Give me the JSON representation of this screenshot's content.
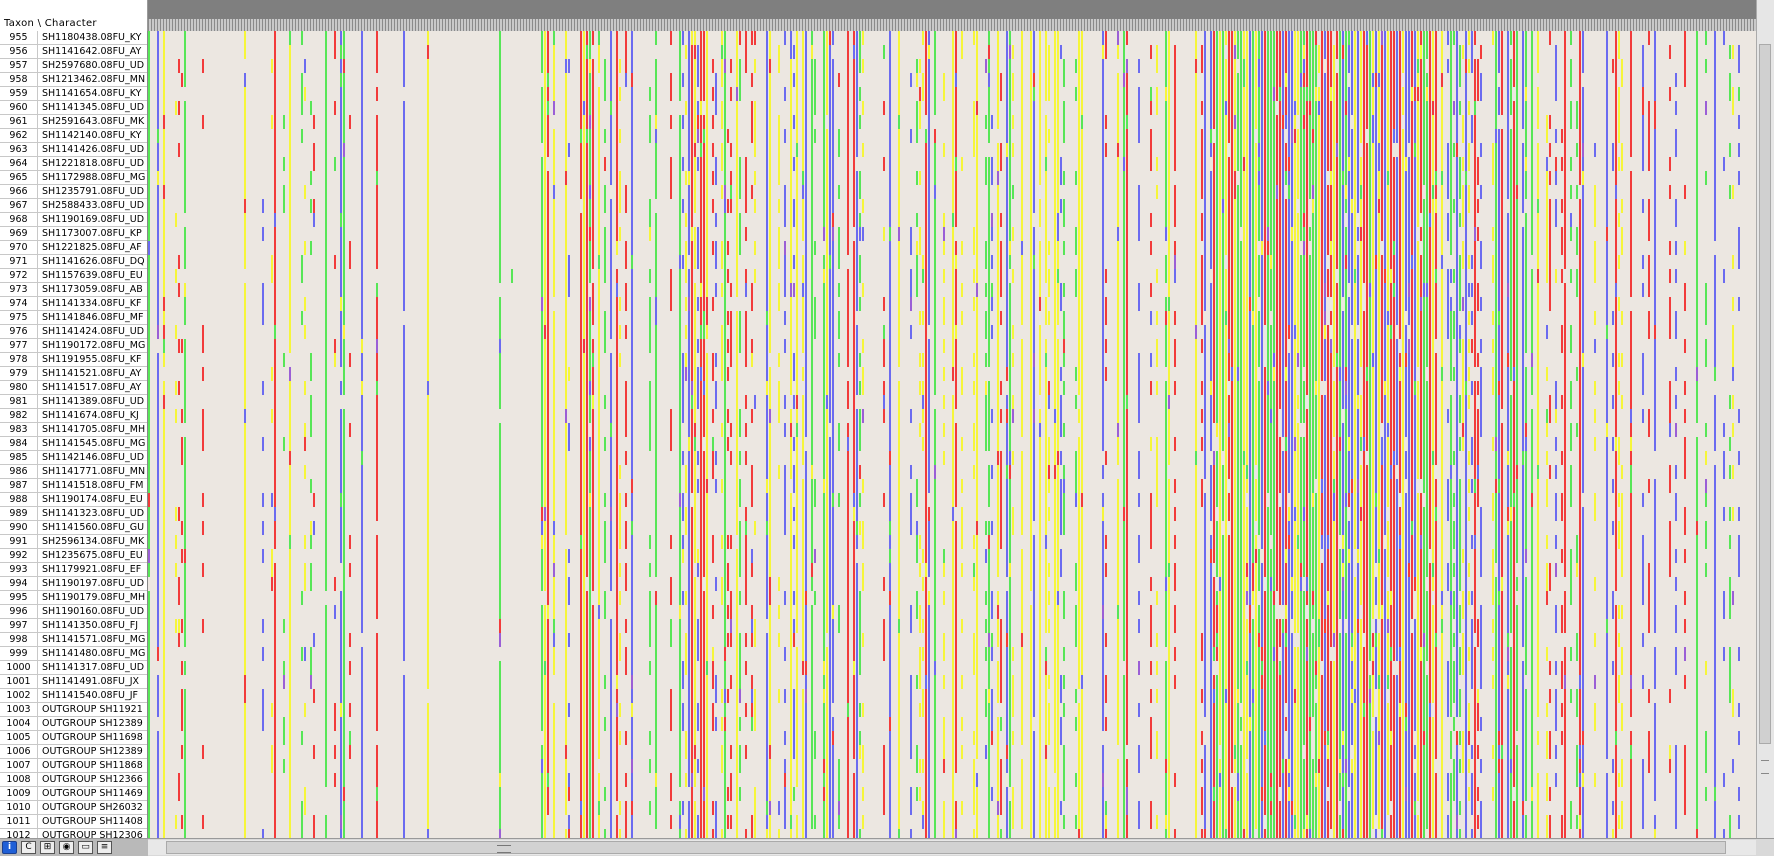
{
  "header": {
    "corner_label": "Taxon \\ Character"
  },
  "rows": [
    {
      "num": "955",
      "name": "SH1180438.08FU_KY"
    },
    {
      "num": "956",
      "name": "SH1141642.08FU_AY"
    },
    {
      "num": "957",
      "name": "SH2597680.08FU_UD"
    },
    {
      "num": "958",
      "name": "SH1213462.08FU_MN"
    },
    {
      "num": "959",
      "name": "SH1141654.08FU_KY"
    },
    {
      "num": "960",
      "name": "SH1141345.08FU_UD"
    },
    {
      "num": "961",
      "name": "SH2591643.08FU_MK"
    },
    {
      "num": "962",
      "name": "SH1142140.08FU_KY"
    },
    {
      "num": "963",
      "name": "SH1141426.08FU_UD"
    },
    {
      "num": "964",
      "name": "SH1221818.08FU_UD"
    },
    {
      "num": "965",
      "name": "SH1172988.08FU_MG"
    },
    {
      "num": "966",
      "name": "SH1235791.08FU_UD"
    },
    {
      "num": "967",
      "name": "SH2588433.08FU_UD"
    },
    {
      "num": "968",
      "name": "SH1190169.08FU_UD"
    },
    {
      "num": "969",
      "name": "SH1173007.08FU_KP"
    },
    {
      "num": "970",
      "name": "SH1221825.08FU_AF"
    },
    {
      "num": "971",
      "name": "SH1141626.08FU_DQ"
    },
    {
      "num": "972",
      "name": "SH1157639.08FU_EU"
    },
    {
      "num": "973",
      "name": "SH1173059.08FU_AB"
    },
    {
      "num": "974",
      "name": "SH1141334.08FU_KF"
    },
    {
      "num": "975",
      "name": "SH1141846.08FU_MF"
    },
    {
      "num": "976",
      "name": "SH1141424.08FU_UD"
    },
    {
      "num": "977",
      "name": "SH1190172.08FU_MG"
    },
    {
      "num": "978",
      "name": "SH1191955.08FU_KF"
    },
    {
      "num": "979",
      "name": "SH1141521.08FU_AY"
    },
    {
      "num": "980",
      "name": "SH1141517.08FU_AY"
    },
    {
      "num": "981",
      "name": "SH1141389.08FU_UD"
    },
    {
      "num": "982",
      "name": "SH1141674.08FU_KJ"
    },
    {
      "num": "983",
      "name": "SH1141705.08FU_MH"
    },
    {
      "num": "984",
      "name": "SH1141545.08FU_MG"
    },
    {
      "num": "985",
      "name": "SH1142146.08FU_UD"
    },
    {
      "num": "986",
      "name": "SH1141771.08FU_MN"
    },
    {
      "num": "987",
      "name": "SH1141518.08FU_FM"
    },
    {
      "num": "988",
      "name": "SH1190174.08FU_EU"
    },
    {
      "num": "989",
      "name": "SH1141323.08FU_UD"
    },
    {
      "num": "990",
      "name": "SH1141560.08FU_GU"
    },
    {
      "num": "991",
      "name": "SH2596134.08FU_MK"
    },
    {
      "num": "992",
      "name": "SH1235675.08FU_EU"
    },
    {
      "num": "993",
      "name": "SH1179921.08FU_EF"
    },
    {
      "num": "994",
      "name": "SH1190197.08FU_UD"
    },
    {
      "num": "995",
      "name": "SH1190179.08FU_MH"
    },
    {
      "num": "996",
      "name": "SH1190160.08FU_UD"
    },
    {
      "num": "997",
      "name": "SH1141350.08FU_FJ"
    },
    {
      "num": "998",
      "name": "SH1141571.08FU_MG"
    },
    {
      "num": "999",
      "name": "SH1141480.08FU_MG"
    },
    {
      "num": "1000",
      "name": "SH1141317.08FU_UD"
    },
    {
      "num": "1001",
      "name": "SH1141491.08FU_JX"
    },
    {
      "num": "1002",
      "name": "SH1141540.08FU_JF"
    },
    {
      "num": "1003",
      "name": "OUTGROUP SH11921"
    },
    {
      "num": "1004",
      "name": "OUTGROUP SH12389"
    },
    {
      "num": "1005",
      "name": "OUTGROUP SH11698"
    },
    {
      "num": "1006",
      "name": "OUTGROUP SH12389"
    },
    {
      "num": "1007",
      "name": "OUTGROUP SH11868"
    },
    {
      "num": "1008",
      "name": "OUTGROUP SH12366"
    },
    {
      "num": "1009",
      "name": "OUTGROUP SH11469"
    },
    {
      "num": "1010",
      "name": "OUTGROUP SH26032"
    },
    {
      "num": "1011",
      "name": "OUTGROUP SH11408"
    },
    {
      "num": "1012",
      "name": "OUTGROUP SH12306"
    }
  ],
  "matrix": {
    "background": "#ece7e1",
    "state_colors": {
      "A": "#f23b3b",
      "C": "#6b6bf0",
      "G": "#f6f63a",
      "T": "#57e657",
      "ambiguous": "#9b5fd6"
    }
  },
  "toolbar": {
    "tools": [
      {
        "icon": "info-icon",
        "glyph": "i"
      },
      {
        "icon": "character-cell-icon",
        "glyph": "C"
      },
      {
        "icon": "select-table-icon",
        "glyph": "⊞"
      },
      {
        "icon": "magnifier-icon",
        "glyph": "◉"
      },
      {
        "icon": "window-icon",
        "glyph": "▭"
      },
      {
        "icon": "list-icon",
        "glyph": "≡"
      }
    ]
  }
}
